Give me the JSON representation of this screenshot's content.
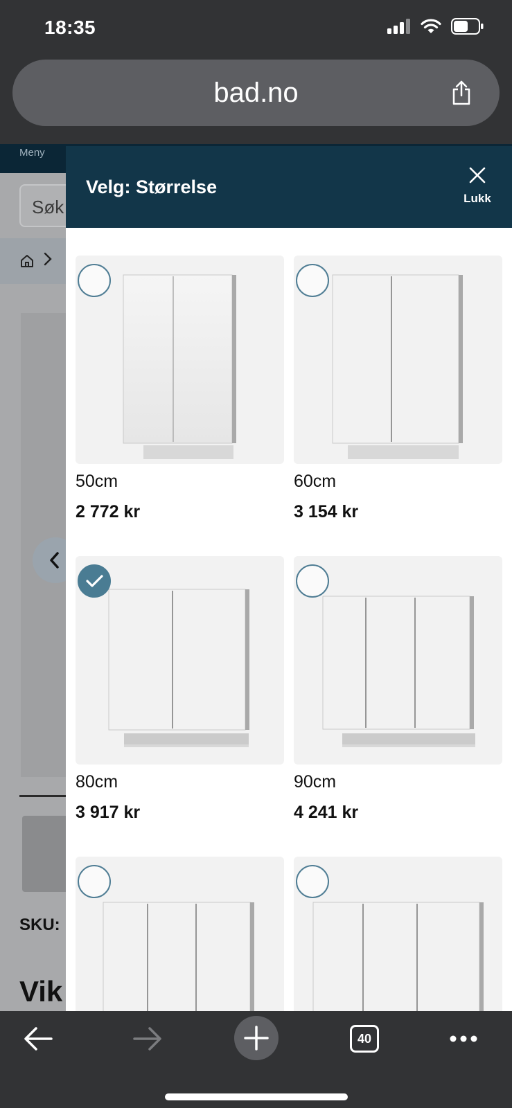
{
  "status_bar": {
    "time": "18:35",
    "battery_level": 0.6
  },
  "browser": {
    "url": "bad.no",
    "tab_count": "40"
  },
  "page": {
    "nav_label": "Meny",
    "search_text": "Søk",
    "sku_label": "SKU:",
    "title_partial": "Vik"
  },
  "modal": {
    "title": "Velg: Størrelse",
    "close_label": "Lukk",
    "options": [
      {
        "size": "50cm",
        "price": "2 772 kr",
        "selected": false,
        "doors": 2
      },
      {
        "size": "60cm",
        "price": "3 154 kr",
        "selected": false,
        "doors": 2
      },
      {
        "size": "80cm",
        "price": "3 917 kr",
        "selected": true,
        "doors": 2
      },
      {
        "size": "90cm",
        "price": "4 241 kr",
        "selected": false,
        "doors": 3
      },
      {
        "size": "",
        "price": "",
        "selected": false,
        "doors": 3
      },
      {
        "size": "",
        "price": "",
        "selected": false,
        "doors": 3
      }
    ]
  },
  "colors": {
    "modal_header": "#123649",
    "radio_accent": "#4a7c93",
    "browser_chrome": "#323335"
  },
  "icons": {
    "signal": "signal-icon",
    "wifi": "wifi-icon",
    "battery": "battery-icon",
    "share": "share-icon",
    "close": "close-icon",
    "check": "check-icon",
    "back": "back-arrow-icon",
    "forward": "forward-arrow-icon",
    "plus": "plus-icon",
    "tabs": "tabs-icon",
    "more": "more-icon",
    "home": "home-icon",
    "chevron_left": "chevron-left-icon"
  }
}
